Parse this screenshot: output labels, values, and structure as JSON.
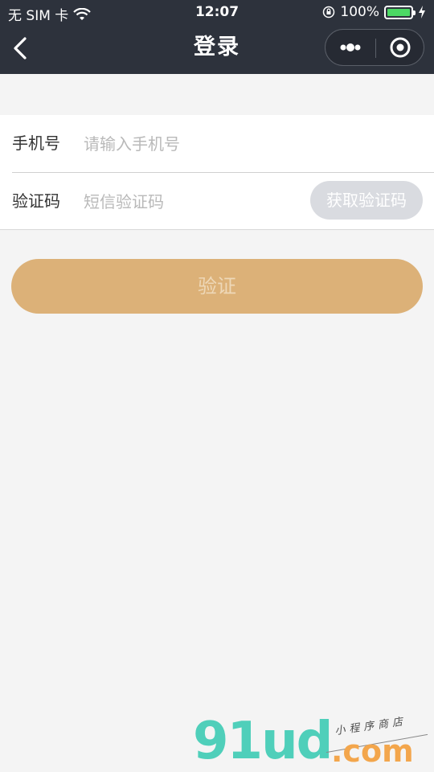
{
  "status_bar": {
    "carrier": "无 SIM 卡",
    "time": "12:07",
    "battery_percent": "100%",
    "battery_level": 1.0
  },
  "nav": {
    "title": "登录"
  },
  "form": {
    "phone": {
      "label": "手机号",
      "placeholder": "请输入手机号",
      "value": ""
    },
    "code": {
      "label": "验证码",
      "placeholder": "短信验证码",
      "value": "",
      "button_label": "获取验证码"
    }
  },
  "verify_button": {
    "label": "验证"
  },
  "watermark": {
    "brand": "91ud",
    "tld": ".com",
    "tagline": "小程序商店"
  },
  "colors": {
    "nav_bg": "#2d323c",
    "page_bg": "#f4f4f4",
    "accent": "#dcb178",
    "code_button_bg": "#d9dbe0",
    "battery": "#4cd964"
  },
  "icons": {
    "back": "chevron-left-icon",
    "more": "more-dots-icon",
    "close": "target-circle-icon",
    "wifi": "wifi-icon",
    "lock": "orientation-lock-icon",
    "charging": "charging-bolt-icon"
  }
}
